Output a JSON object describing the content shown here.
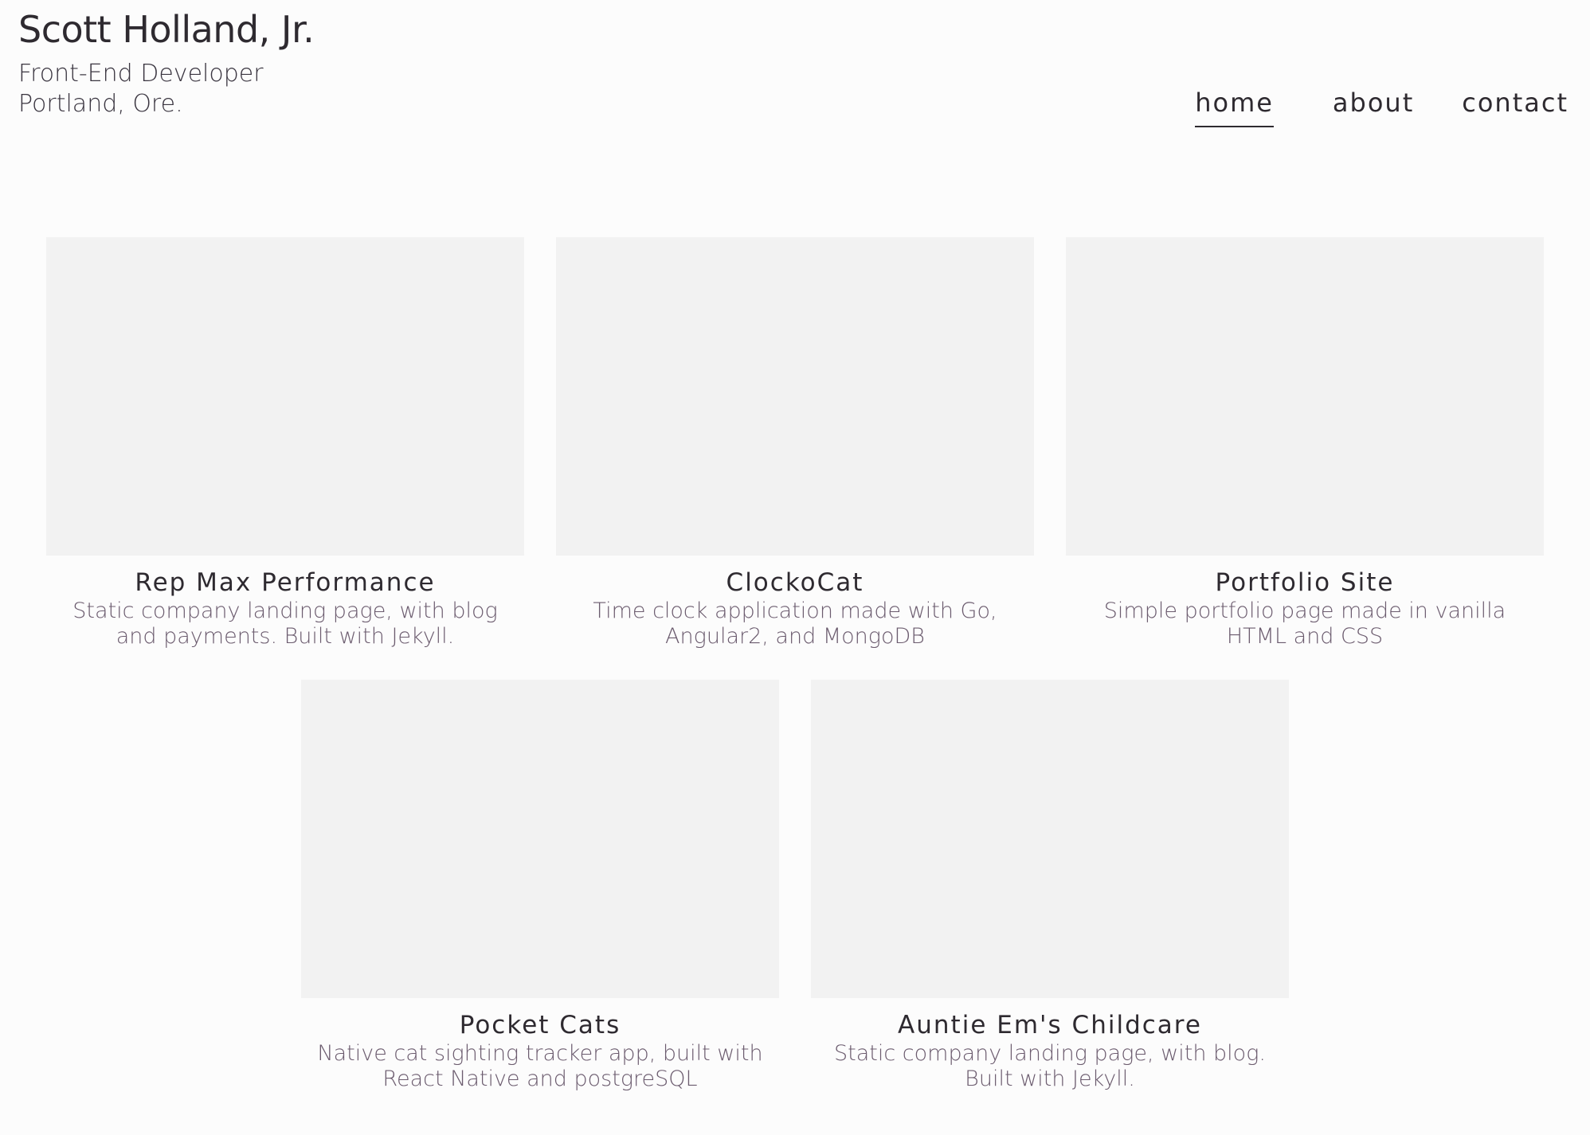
{
  "header": {
    "name": "Scott Holland, Jr.",
    "role": "Front-End Developer",
    "location": "Portland, Ore."
  },
  "nav": {
    "home": "home",
    "about": "about",
    "contact": "contact",
    "active": "home"
  },
  "projects": [
    {
      "title": "Rep Max Performance",
      "description": "Static company landing page, with blog and payments. Built with Jekyll."
    },
    {
      "title": "ClockoCat",
      "description": "Time clock application made with Go, Angular2, and MongoDB"
    },
    {
      "title": "Portfolio Site",
      "description": "Simple portfolio page made in vanilla HTML and CSS"
    },
    {
      "title": "Pocket Cats",
      "description": "Native cat sighting tracker app, built with React Native and postgreSQL"
    },
    {
      "title": "Auntie Em's Childcare",
      "description": "Static company landing page, with blog. Built with Jekyll."
    }
  ],
  "colors": {
    "background": "#fcfcfc",
    "text": "#2e2a30",
    "description": "#6b5b6e",
    "thumbnail": "#f2f2f2"
  }
}
